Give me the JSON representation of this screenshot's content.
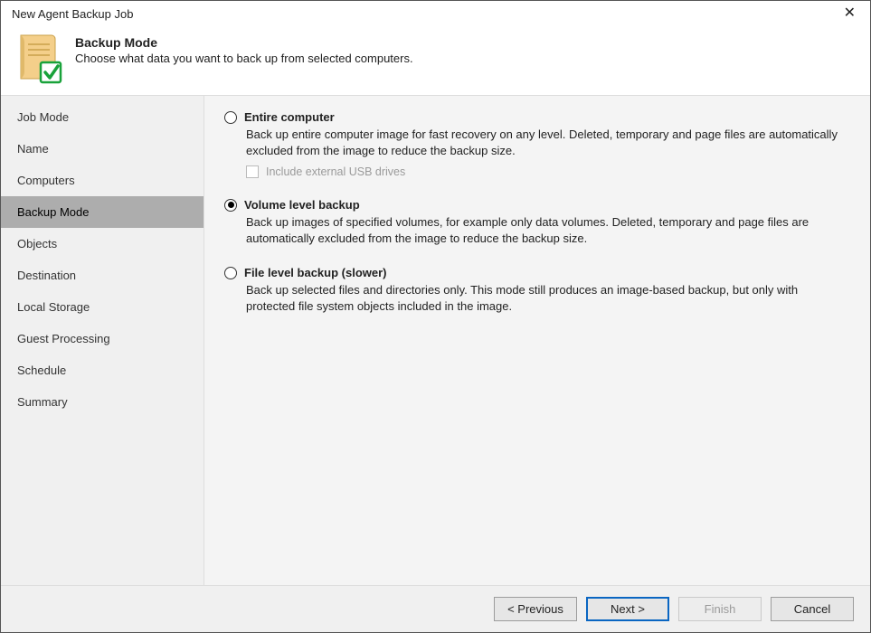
{
  "window": {
    "title": "New Agent Backup Job"
  },
  "header": {
    "title": "Backup Mode",
    "subtitle": "Choose what data you want to back up from selected computers."
  },
  "sidebar": {
    "items": [
      {
        "label": "Job Mode",
        "active": false
      },
      {
        "label": "Name",
        "active": false
      },
      {
        "label": "Computers",
        "active": false
      },
      {
        "label": "Backup Mode",
        "active": true
      },
      {
        "label": "Objects",
        "active": false
      },
      {
        "label": "Destination",
        "active": false
      },
      {
        "label": "Local Storage",
        "active": false
      },
      {
        "label": "Guest Processing",
        "active": false
      },
      {
        "label": "Schedule",
        "active": false
      },
      {
        "label": "Summary",
        "active": false
      }
    ]
  },
  "options": [
    {
      "id": "entire-computer",
      "title": "Entire computer",
      "desc": "Back up entire computer image for fast recovery on any level. Deleted, temporary and page files are automatically excluded from the image to reduce the backup size.",
      "selected": false,
      "sub_checkbox": {
        "label": "Include external USB drives",
        "checked": false,
        "enabled": false
      }
    },
    {
      "id": "volume-level",
      "title": "Volume level backup",
      "desc": "Back up images of specified volumes, for example only data volumes. Deleted, temporary and page files are automatically excluded from the image to reduce the backup size.",
      "selected": true
    },
    {
      "id": "file-level",
      "title": "File level backup (slower)",
      "desc": "Back up selected files and directories only. This mode still produces an image-based backup, but only with protected file system objects included in the image.",
      "selected": false
    }
  ],
  "footer": {
    "previous": "< Previous",
    "next": "Next >",
    "finish": "Finish",
    "cancel": "Cancel"
  }
}
